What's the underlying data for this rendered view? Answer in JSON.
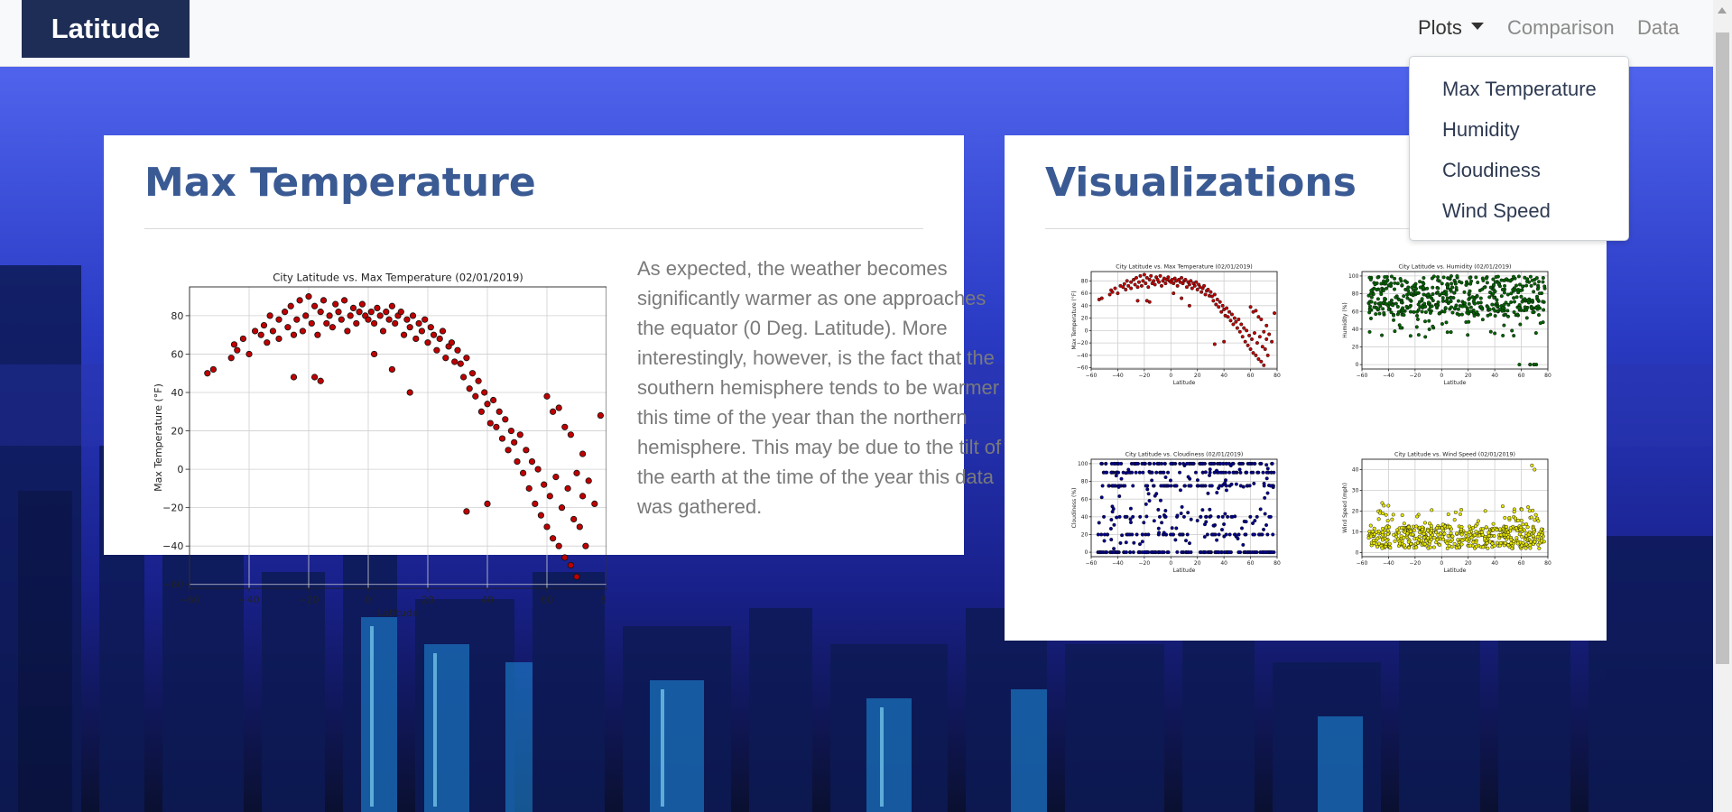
{
  "navbar": {
    "brand": "Latitude",
    "links": [
      {
        "label": "Plots",
        "active": true
      },
      {
        "label": "Comparison"
      },
      {
        "label": "Data"
      }
    ],
    "dropdown": [
      "Max Temperature",
      "Humidity",
      "Cloudiness",
      "Wind Speed"
    ]
  },
  "main_card": {
    "title": "Max Temperature",
    "description": "As expected, the weather becomes significantly warmer as one approaches the equator (0 Deg. Latitude). More interestingly, however, is the fact that the southern hemisphere tends to be warmer this time of the year than the northern hemisphere. This may be due to the tilt of the earth at the time of the year this data was gathered."
  },
  "viz_card": {
    "title": "Visualizations"
  },
  "colors": {
    "brand_bg": "#1e2d55",
    "title": "#3a5a94",
    "temp_points": "#c00000",
    "humidity_points": "#006400",
    "cloudiness_points": "#00008b",
    "wind_points": "#e6e600"
  },
  "chart_data": [
    {
      "id": "main-temp",
      "type": "scatter",
      "title": "City Latitude vs. Max Temperature (02/01/2019)",
      "xlabel": "Latitude",
      "ylabel": "Max Temperature (°F)",
      "xlim": [
        -60,
        80
      ],
      "ylim": [
        -62,
        95
      ],
      "xticks": [
        -60,
        -40,
        -20,
        0,
        20,
        40,
        60,
        80
      ],
      "yticks": [
        -60,
        -40,
        -20,
        0,
        20,
        40,
        60,
        80
      ],
      "color": "#c00000",
      "grid": true,
      "points": [
        [
          -54,
          50
        ],
        [
          -52,
          52
        ],
        [
          -46,
          58
        ],
        [
          -45,
          65
        ],
        [
          -44,
          62
        ],
        [
          -42,
          68
        ],
        [
          -40,
          60
        ],
        [
          -38,
          72
        ],
        [
          -36,
          70
        ],
        [
          -35,
          75
        ],
        [
          -34,
          66
        ],
        [
          -33,
          80
        ],
        [
          -32,
          72
        ],
        [
          -30,
          78
        ],
        [
          -30,
          68
        ],
        [
          -28,
          82
        ],
        [
          -27,
          74
        ],
        [
          -26,
          85
        ],
        [
          -25,
          70
        ],
        [
          -24,
          78
        ],
        [
          -23,
          88
        ],
        [
          -22,
          72
        ],
        [
          -21,
          80
        ],
        [
          -20,
          90
        ],
        [
          -19,
          76
        ],
        [
          -18,
          85
        ],
        [
          -17,
          70
        ],
        [
          -16,
          82
        ],
        [
          -15,
          88
        ],
        [
          -14,
          76
        ],
        [
          -13,
          80
        ],
        [
          -12,
          74
        ],
        [
          -11,
          86
        ],
        [
          -10,
          82
        ],
        [
          -9,
          78
        ],
        [
          -8,
          88
        ],
        [
          -7,
          72
        ],
        [
          -6,
          80
        ],
        [
          -5,
          84
        ],
        [
          -4,
          76
        ],
        [
          -3,
          82
        ],
        [
          -2,
          86
        ],
        [
          -1,
          80
        ],
        [
          0,
          78
        ],
        [
          1,
          82
        ],
        [
          2,
          76
        ],
        [
          3,
          84
        ],
        [
          4,
          80
        ],
        [
          5,
          72
        ],
        [
          6,
          82
        ],
        [
          7,
          78
        ],
        [
          8,
          85
        ],
        [
          9,
          76
        ],
        [
          10,
          80
        ],
        [
          11,
          82
        ],
        [
          12,
          70
        ],
        [
          13,
          78
        ],
        [
          14,
          74
        ],
        [
          15,
          80
        ],
        [
          16,
          68
        ],
        [
          17,
          76
        ],
        [
          18,
          72
        ],
        [
          19,
          78
        ],
        [
          20,
          66
        ],
        [
          21,
          74
        ],
        [
          22,
          70
        ],
        [
          23,
          62
        ],
        [
          24,
          68
        ],
        [
          25,
          72
        ],
        [
          26,
          58
        ],
        [
          27,
          64
        ],
        [
          28,
          66
        ],
        [
          29,
          56
        ],
        [
          30,
          62
        ],
        [
          31,
          55
        ],
        [
          32,
          48
        ],
        [
          33,
          58
        ],
        [
          34,
          42
        ],
        [
          35,
          50
        ],
        [
          36,
          38
        ],
        [
          37,
          46
        ],
        [
          38,
          30
        ],
        [
          39,
          40
        ],
        [
          40,
          34
        ],
        [
          41,
          24
        ],
        [
          42,
          36
        ],
        [
          43,
          22
        ],
        [
          44,
          30
        ],
        [
          45,
          16
        ],
        [
          46,
          26
        ],
        [
          47,
          10
        ],
        [
          48,
          20
        ],
        [
          49,
          14
        ],
        [
          50,
          4
        ],
        [
          51,
          18
        ],
        [
          52,
          -2
        ],
        [
          53,
          10
        ],
        [
          54,
          -10
        ],
        [
          55,
          4
        ],
        [
          56,
          -18
        ],
        [
          57,
          0
        ],
        [
          58,
          -24
        ],
        [
          59,
          -8
        ],
        [
          60,
          -30
        ],
        [
          61,
          -14
        ],
        [
          62,
          -36
        ],
        [
          63,
          -4
        ],
        [
          64,
          -40
        ],
        [
          65,
          -20
        ],
        [
          66,
          -46
        ],
        [
          67,
          -10
        ],
        [
          68,
          -50
        ],
        [
          69,
          -26
        ],
        [
          70,
          -56
        ],
        [
          71,
          -30
        ],
        [
          72,
          -14
        ],
        [
          73,
          -40
        ],
        [
          74,
          -6
        ],
        [
          76,
          -18
        ],
        [
          78,
          28
        ],
        [
          60,
          38
        ],
        [
          62,
          30
        ],
        [
          64,
          32
        ],
        [
          66,
          22
        ],
        [
          68,
          18
        ],
        [
          70,
          -2
        ],
        [
          72,
          8
        ],
        [
          33,
          -22
        ],
        [
          40,
          -18
        ],
        [
          -18,
          48
        ],
        [
          -16,
          46
        ],
        [
          -25,
          48
        ],
        [
          2,
          60
        ],
        [
          8,
          52
        ],
        [
          14,
          40
        ]
      ]
    },
    {
      "id": "thumb-temp",
      "type": "scatter",
      "title": "City Latitude vs. Max Temperature (02/01/2019)",
      "xlabel": "Latitude",
      "ylabel": "Max Temperature (°F)",
      "xlim": [
        -60,
        80
      ],
      "ylim": [
        -62,
        95
      ],
      "xticks": [
        -60,
        -40,
        -20,
        0,
        20,
        40,
        60,
        80
      ],
      "yticks": [
        -60,
        -40,
        -20,
        0,
        20,
        40,
        60,
        80
      ],
      "color": "#c00000",
      "grid": true
    },
    {
      "id": "thumb-humidity",
      "type": "scatter",
      "title": "City Latitude vs. Humidity (02/01/2019)",
      "xlabel": "Latitude",
      "ylabel": "Humidity (%)",
      "xlim": [
        -60,
        80
      ],
      "ylim": [
        -5,
        105
      ],
      "xticks": [
        -60,
        -40,
        -20,
        0,
        20,
        40,
        60,
        80
      ],
      "yticks": [
        0,
        20,
        40,
        60,
        80,
        100
      ],
      "color": "#006400",
      "grid": true
    },
    {
      "id": "thumb-cloudiness",
      "type": "scatter",
      "title": "City Latitude vs. Cloudiness (02/01/2019)",
      "xlabel": "Latitude",
      "ylabel": "Cloudiness (%)",
      "xlim": [
        -60,
        80
      ],
      "ylim": [
        -5,
        105
      ],
      "xticks": [
        -60,
        -40,
        -20,
        0,
        20,
        40,
        60,
        80
      ],
      "yticks": [
        0,
        20,
        40,
        60,
        80,
        100
      ],
      "color": "#00008b",
      "grid": true
    },
    {
      "id": "thumb-wind",
      "type": "scatter",
      "title": "City Latitude vs. Wind Speed (02/01/2019)",
      "xlabel": "Latitude",
      "ylabel": "Wind Speed (mph)",
      "xlim": [
        -60,
        80
      ],
      "ylim": [
        -2,
        45
      ],
      "xticks": [
        -60,
        -40,
        -20,
        0,
        20,
        40,
        60,
        80
      ],
      "yticks": [
        0,
        10,
        20,
        30,
        40
      ],
      "color": "#e6e600",
      "grid": true
    }
  ]
}
